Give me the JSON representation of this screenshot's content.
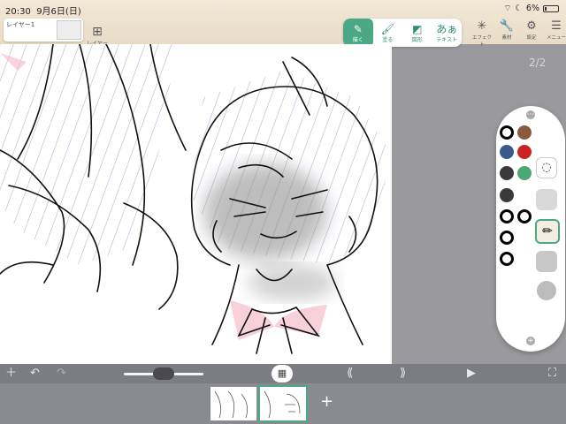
{
  "status": {
    "time": "20:30",
    "date": "9月6日(日)",
    "battery": "6%"
  },
  "layer": {
    "name": "レイヤー1",
    "add_label": "レイヤー"
  },
  "tools": [
    {
      "label": "描く",
      "icon": "pen-icon"
    },
    {
      "label": "塗る",
      "icon": "brush-icon"
    },
    {
      "label": "図形",
      "icon": "shape-icon"
    },
    {
      "label": "テキスト",
      "icon_text": "あぁ"
    }
  ],
  "right_tools": [
    {
      "label": "エフェクト",
      "icon": "effect-icon"
    },
    {
      "label": "素材",
      "icon": "wrench-icon"
    },
    {
      "label": "設定",
      "icon": "gear-icon"
    },
    {
      "label": "メニュー",
      "icon": "menu-icon"
    }
  ],
  "page_indicator": "2/2",
  "palette": {
    "colors": [
      "#000000",
      "#8a5a3c",
      "#3a5a8a",
      "#cc2222",
      "#3a3a3a",
      "#4aa874",
      "#3a3a3a"
    ],
    "accent": "#4aa884"
  }
}
